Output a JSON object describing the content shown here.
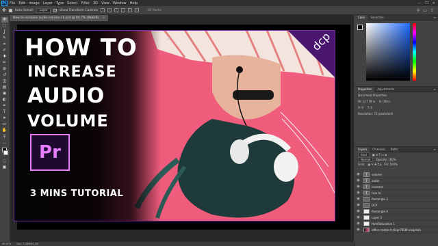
{
  "menu": {
    "app_logo": "Ps",
    "items": [
      "File",
      "Edit",
      "Image",
      "Layer",
      "Type",
      "Select",
      "Filter",
      "3D",
      "View",
      "Window",
      "Help"
    ],
    "window_controls": [
      "—",
      "❐",
      "✕"
    ]
  },
  "options": {
    "auto_select_label": "Auto-Select:",
    "auto_select_value": "Layer",
    "show_transform_label": "Show Transform Controls",
    "mode_label": "3D Mode:"
  },
  "document": {
    "tab_title": "How to increase audio volume v1.psd @ 66.7% (RGB/8)",
    "close": "×"
  },
  "artwork": {
    "line1": "HOW TO",
    "line2": "INCREASE",
    "line3": "AUDIO",
    "line4": "VOLUME",
    "logo_text": "Pr",
    "tutorial": "3 MINS TUTORIAL",
    "badge_text": "dcp",
    "colors": {
      "accent": "#e77cff",
      "background": "#ef5c7c",
      "border": "#7a2fa0"
    }
  },
  "toolbar": {
    "tools": [
      "move-icon",
      "marquee-icon",
      "lasso-icon",
      "quick-select-icon",
      "crop-icon",
      "eyedropper-icon",
      "healing-icon",
      "brush-icon",
      "stamp-icon",
      "history-brush-icon",
      "eraser-icon",
      "gradient-icon",
      "blur-icon",
      "dodge-icon",
      "pen-icon",
      "type-icon",
      "path-select-icon",
      "rectangle-icon",
      "hand-icon",
      "zoom-icon",
      "more-icon"
    ],
    "glyphs": [
      "✥",
      "⬚",
      "ʆ",
      "✎",
      "⌗",
      "✐",
      "✚",
      "✏",
      "⊕",
      "↺",
      "◫",
      "▤",
      "◉",
      "◐",
      "✒",
      "T",
      "➤",
      "▭",
      "✋",
      "⚲",
      "…"
    ]
  },
  "color_panel": {
    "tabs": [
      "Color",
      "Swatches"
    ]
  },
  "properties_panel": {
    "tabs": [
      "Properties",
      "Adjustments"
    ],
    "doc_props": "Document Properties",
    "w": "W: 12.778 in",
    "h": "H: 10 in",
    "x": "X: 0",
    "y": "Y: 0",
    "resolution": "Resolution: 72 pixels/inch"
  },
  "layers_panel": {
    "tabs": [
      "Layers",
      "Channels",
      "Paths"
    ],
    "kind": "Kind",
    "blend": "Normal",
    "opacity": "Opacity: 100%",
    "lock": "Lock:",
    "fill": "Fill: 100%",
    "layers": [
      {
        "name": "volume",
        "thumb": "T"
      },
      {
        "name": "audio",
        "thumb": "T"
      },
      {
        "name": "increase",
        "thumb": "T"
      },
      {
        "name": "how to",
        "thumb": "T"
      },
      {
        "name": "Rectangle 3",
        "thumb": ""
      },
      {
        "name": "DCP",
        "thumb": ""
      },
      {
        "name": "Rectangle 4",
        "thumb": ""
      },
      {
        "name": "Layer 3",
        "thumb": ""
      },
      {
        "name": "Hue/Saturation 1",
        "thumb": ""
      },
      {
        "name": "office-nestre-0-r8cpr76E8f-unsplash",
        "thumb": ""
      }
    ]
  },
  "status": {
    "zoom": "66.67%",
    "doc": "Doc: 2.44M/61.2M"
  }
}
